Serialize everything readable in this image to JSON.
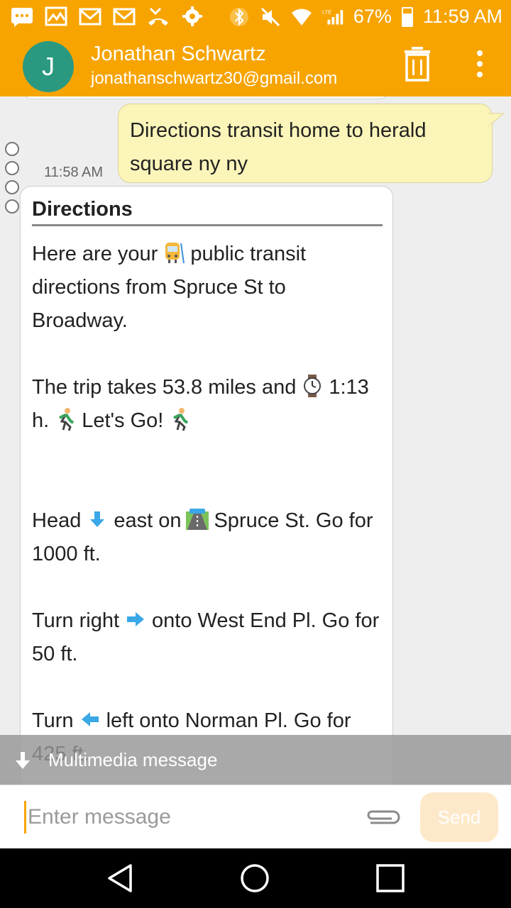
{
  "status_bar": {
    "battery_percent": "67%",
    "battery_level": 0.67,
    "time": "11:59 AM",
    "network": "LTE",
    "notification_icons": [
      "message-icon",
      "image-icon",
      "gmail-icon",
      "gmail-icon",
      "missed-call-icon",
      "settings-icon"
    ],
    "system_icons": [
      "bluetooth-icon",
      "mute-icon",
      "wifi-icon",
      "signal-icon",
      "battery-icon"
    ]
  },
  "app_bar": {
    "avatar_letter": "J",
    "avatar_color": "#2a9980",
    "accent_color": "#f7a400",
    "contact_name": "Jonathan Schwartz",
    "contact_email": "jonathanschwartz30@gmail.com"
  },
  "conversation": {
    "outgoing": {
      "text": "Directions transit home to herald square ny ny",
      "time": "11:58 AM"
    },
    "incoming": {
      "title": "Directions",
      "intro_before": "Here are your",
      "intro_after": "public transit directions from Spruce St to Broadway.",
      "trip_before": "The trip takes 53.8 miles and",
      "trip_after": "1:13 h.",
      "trip_go": "Let's Go!",
      "step1_before": "Head",
      "step1_mid": "east on",
      "step1_after": "Spruce St. Go for 1000 ft.",
      "step2_before": "Turn right",
      "step2_after": "onto West End Pl. Go for 50 ft.",
      "step3_before": "Turn",
      "step3_after": "left onto Norman Pl. Go for 425 ft."
    }
  },
  "mms_bar": {
    "label": "Multimedia message"
  },
  "composer": {
    "placeholder": "Enter message",
    "send_label": "Send"
  }
}
